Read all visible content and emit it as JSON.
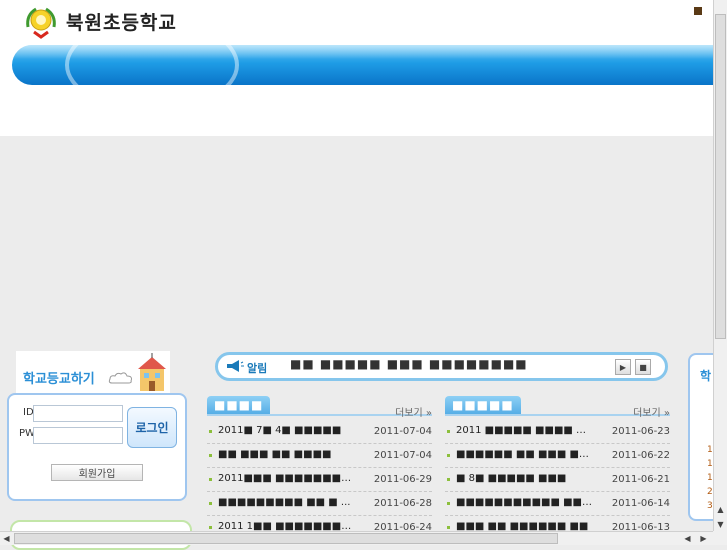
{
  "header": {
    "school_name": "북원초등학교",
    "logo_icon": "school-emblem-icon"
  },
  "login": {
    "panel_title": "학교등교하기",
    "id_label": "ID",
    "pw_label": "PW",
    "login_button": "로그인",
    "signup_button": "회원가입"
  },
  "ticker": {
    "label": "알림",
    "icon": "megaphone-icon",
    "text": "■■ ■■■■■ ■■■ ■■■■■■■■",
    "play_icon": "▶",
    "stop_icon": "■"
  },
  "boards": [
    {
      "tab": "■■■■",
      "more": "더보기 »",
      "items": [
        {
          "title": "2011■ 7■ 4■ ■■■■■",
          "date": "2011-07-04"
        },
        {
          "title": "■■ ■■■ ■■ ■■■■",
          "date": "2011-07-04"
        },
        {
          "title": "2011■■■ ■■■■■■■■■■■",
          "date": "2011-06-29"
        },
        {
          "title": "■■■■■■■■■ ■■ ■ ...",
          "date": "2011-06-28"
        },
        {
          "title": "2011 1■■ ■■■■■■■■■",
          "date": "2011-06-24"
        }
      ]
    },
    {
      "tab": "■■■■■",
      "more": "더보기 »",
      "items": [
        {
          "title": "2011 ■■■■■ ■■■■ ■■■■",
          "date": "2011-06-23"
        },
        {
          "title": "■■■■■■ ■■ ■■■ ■■■",
          "date": "2011-06-22"
        },
        {
          "title": "■ 8■ ■■■■■ ■■■",
          "date": "2011-06-21"
        },
        {
          "title": "■■■■■■■■■■■ ■■ ■■",
          "date": "2011-06-14"
        },
        {
          "title": "■■■ ■■ ■■■■■■ ■■",
          "date": "2011-06-13"
        }
      ]
    }
  ],
  "right_panel": {
    "tab_label": "학",
    "numbers": [
      "1",
      "1",
      "1",
      "2",
      "3"
    ]
  },
  "colors": {
    "banner_blue": "#1e9ce6",
    "accent_green": "#8cbf3c",
    "link_blue": "#2b8fd6"
  }
}
